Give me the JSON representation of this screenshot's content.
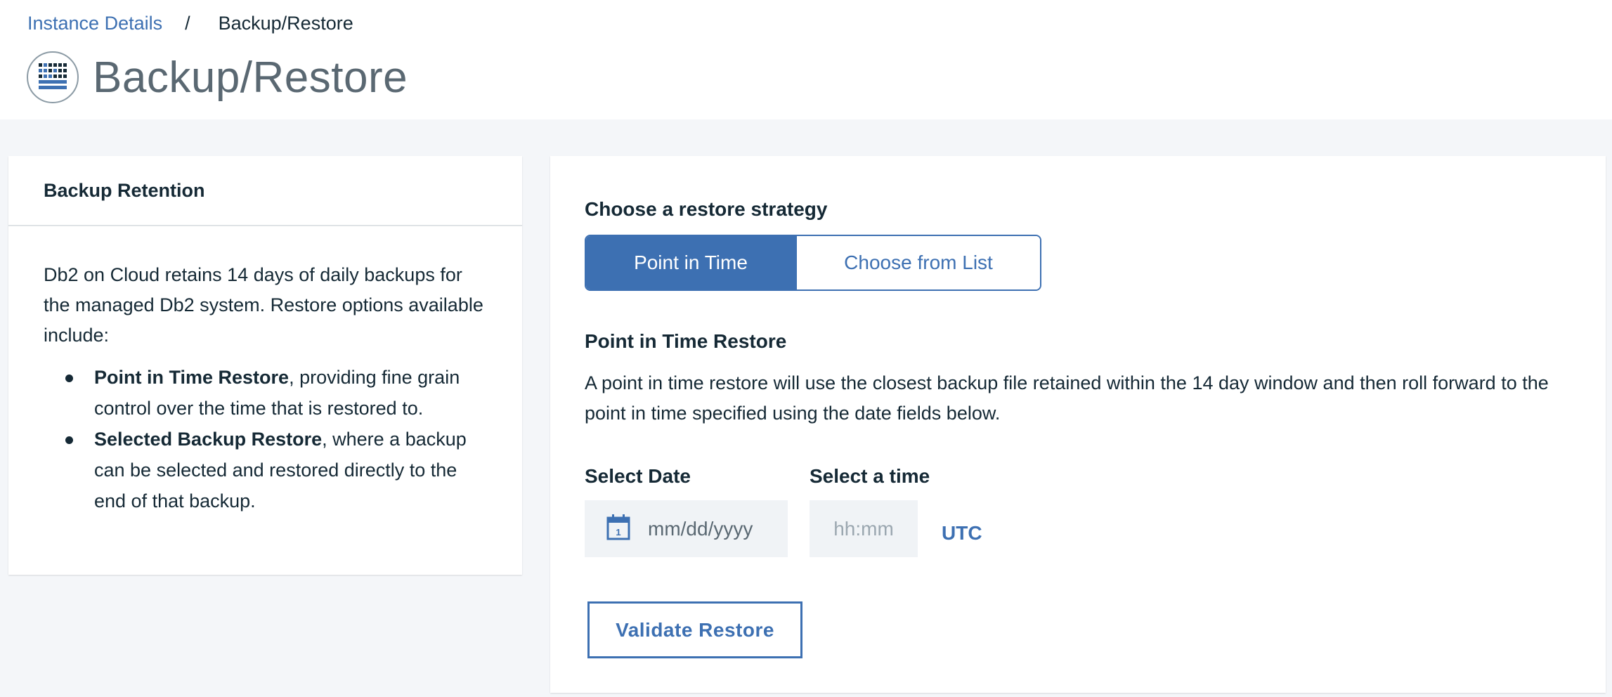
{
  "breadcrumb": {
    "parent": "Instance Details",
    "separator": "/",
    "current": "Backup/Restore"
  },
  "page": {
    "title": "Backup/Restore",
    "icon": "db2-service-icon"
  },
  "retention_card": {
    "title": "Backup Retention",
    "intro": "Db2 on Cloud retains 14 days of daily backups for the managed Db2 system. Restore options available include:",
    "options": [
      {
        "bold": "Point in Time Restore",
        "rest": ", providing fine grain control over the time that is restored to."
      },
      {
        "bold": "Selected Backup Restore",
        "rest": ", where a backup can be selected and restored directly to the end of that backup."
      }
    ]
  },
  "restore_card": {
    "strategy_label": "Choose a restore strategy",
    "strategies": [
      "Point in Time",
      "Choose from List"
    ],
    "selected_strategy": "Point in Time",
    "section_title": "Point in Time Restore",
    "description": "A point in time restore will use the closest backup file retained within the 14 day window and then roll forward to the point in time specified using the date fields below.",
    "date": {
      "label": "Select Date",
      "placeholder": "mm/dd/yyyy",
      "value": "",
      "icon": "calendar-icon"
    },
    "time": {
      "label": "Select a time",
      "placeholder": "hh:mm",
      "value": ""
    },
    "timezone": "UTC",
    "validate_label": "Validate Restore"
  },
  "colors": {
    "accent": "#3d70b2",
    "text": "#152935",
    "muted": "#5a6872",
    "page_bg": "#f4f6f9",
    "input_bg": "#f0f3f6"
  }
}
